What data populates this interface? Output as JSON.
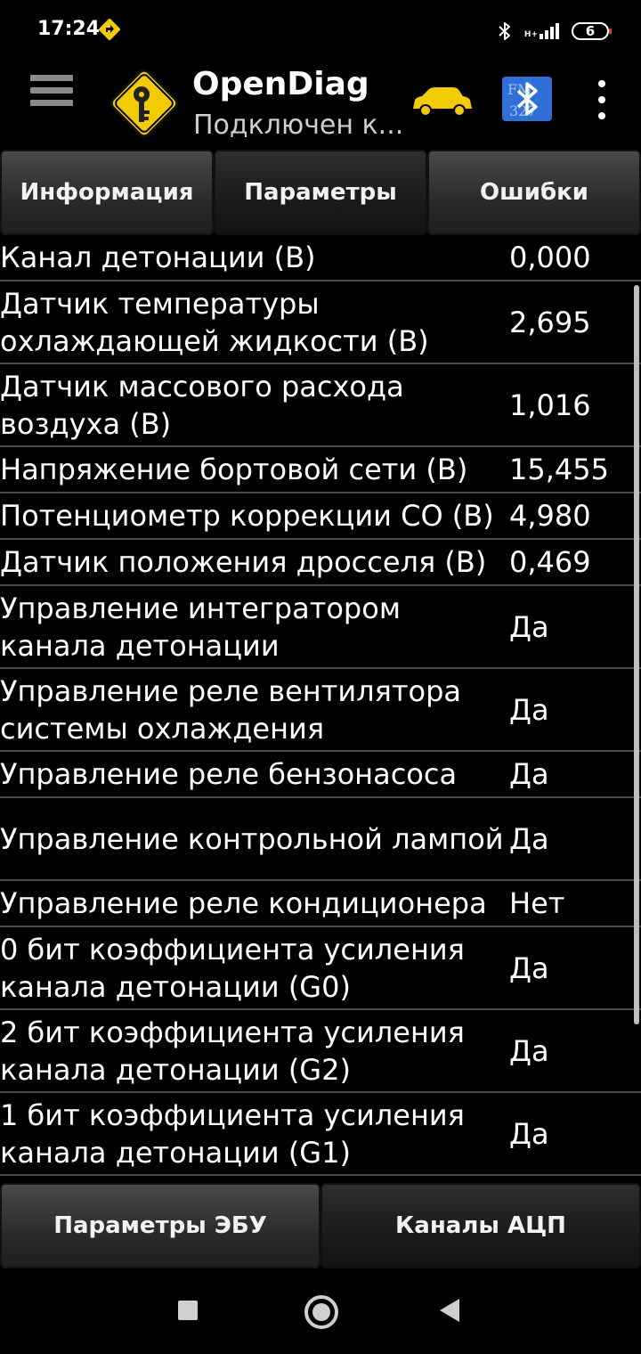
{
  "status_bar": {
    "time": "17:24",
    "network_label": "H+",
    "battery_level": "6",
    "icons": [
      "navigation-icon",
      "bluetooth-icon",
      "signal-icon",
      "battery-icon"
    ]
  },
  "app_bar": {
    "title": "OpenDiag",
    "subtitle": "Подключен к...",
    "logo_text": "FM 327",
    "icons": [
      "menu-icon",
      "key-sign-logo",
      "car-icon",
      "bluetooth-adapter-icon",
      "more-vert-icon"
    ],
    "colors": {
      "car": "#f2cc00",
      "bluetooth_button": "#2f6fd6",
      "logo_sign": "#f2cc00"
    }
  },
  "tabs": [
    {
      "label": "Информация",
      "active": false
    },
    {
      "label": "Параметры",
      "active": true
    },
    {
      "label": "Ошибки",
      "active": false
    }
  ],
  "params": [
    {
      "label": "Канал детонации (В)",
      "value": "0,000"
    },
    {
      "label": "Датчик температуры охлаждающей жидкости (В)",
      "value": "2,695"
    },
    {
      "label": "Датчик массового расхода воздуха (В)",
      "value": "1,016"
    },
    {
      "label": "Напряжение бортовой сети (В)",
      "value": "15,455"
    },
    {
      "label": "Потенциометр коррекции CO (В)",
      "value": "4,980"
    },
    {
      "label": "Датчик положения дросселя (В)",
      "value": "0,469"
    },
    {
      "label": "Управление интегратором канала детонации",
      "value": "Да"
    },
    {
      "label": "Управление реле вентилятора системы охлаждения",
      "value": "Да"
    },
    {
      "label": "Управление реле бензонасоса",
      "value": "Да"
    },
    {
      "label": "Управление контрольной лампой",
      "value": "Да"
    },
    {
      "label": "Управление реле кондиционера",
      "value": "Нет"
    },
    {
      "label": "0 бит коэффициента усиления канала детонации (G0)",
      "value": "Да"
    },
    {
      "label": "2 бит коэффициента усиления канала детонации (G2)",
      "value": "Да"
    },
    {
      "label": "1 бит коэффициента усиления канала детонации (G1)",
      "value": "Да"
    }
  ],
  "bottom_buttons": [
    {
      "label": "Параметры ЭБУ",
      "active": false
    },
    {
      "label": "Каналы АЦП",
      "active": true
    }
  ],
  "system_nav": [
    "recent-apps-icon",
    "home-icon",
    "back-icon"
  ]
}
